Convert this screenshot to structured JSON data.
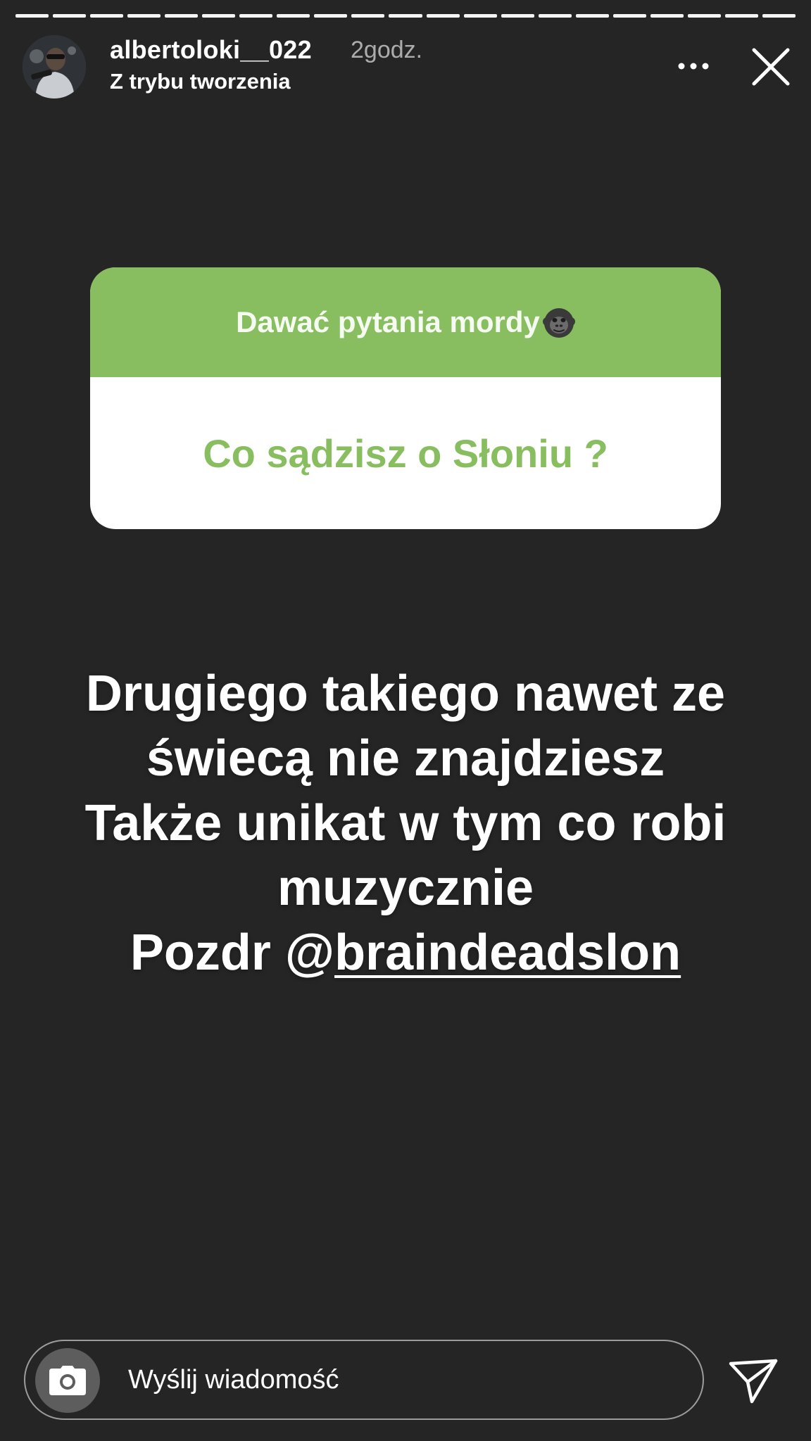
{
  "story": {
    "progress": {
      "total_segments": 21,
      "current_index": 20
    },
    "header": {
      "username": "albertoloki__022",
      "time_ago": "2godz.",
      "subtitle": "Z trybu tworzenia",
      "avatar_icon": "profile-photo",
      "more_icon": "more-horizontal-icon",
      "close_icon": "close-x-icon"
    },
    "question_sticker": {
      "prompt": "Dawać pytania mordy",
      "prompt_emoji": "gorilla-icon",
      "question": "Co sądzisz o Słoniu ?",
      "accent_color": "#88be5f"
    },
    "caption": {
      "line1": "Drugiego takiego nawet ze",
      "line2": "świecą nie znajdziesz",
      "line3": "Także unikat w tym co robi",
      "line4": "muzycznie",
      "line5_prefix": "Pozdr @",
      "mention": "braindeadslon"
    },
    "reply": {
      "placeholder": "Wyślij wiadomość",
      "camera_icon": "camera-icon",
      "send_icon": "send-paper-plane-icon"
    },
    "colors": {
      "background": "#252525",
      "sticker_green": "#88be5f"
    }
  }
}
